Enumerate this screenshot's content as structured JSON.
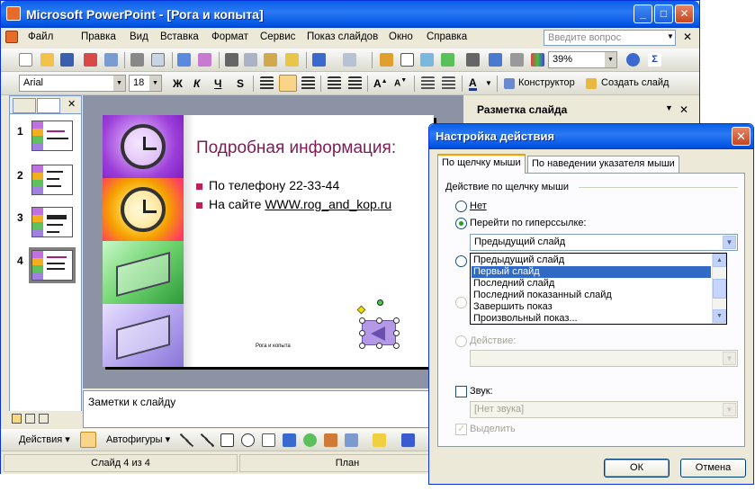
{
  "window": {
    "title": "Microsoft PowerPoint - [Рога и копыта]"
  },
  "menu": {
    "items": [
      "Файл",
      "Правка",
      "Вид",
      "Вставка",
      "Формат",
      "Сервис",
      "Показ слайдов",
      "Окно",
      "Справка"
    ],
    "ask_placeholder": "Введите вопрос"
  },
  "toolbar": {
    "zoom": "39%",
    "font": "Arial",
    "size": "18",
    "bold": "Ж",
    "italic": "К",
    "underline": "Ч",
    "shadow": "S",
    "designer_label": "Конструктор",
    "new_slide_label": "Создать слайд"
  },
  "thumbnails": [
    "1",
    "2",
    "3",
    "4"
  ],
  "slide": {
    "title": "Подробная информация:",
    "bullet1": "По телефону 22-33-44",
    "bullet2_prefix": "На сайте ",
    "bullet2_link": "WWW.rog_and_kop.ru",
    "footer": "Рога и копыта"
  },
  "notes": {
    "placeholder": "Заметки к слайду"
  },
  "drawbar": {
    "actions_label": "Действия",
    "autoshapes_label": "Автофигуры"
  },
  "statusbar": {
    "slide_info": "Слайд 4 из 4",
    "design": "План"
  },
  "taskpane": {
    "title": "Разметка слайда"
  },
  "dialog": {
    "title": "Настройка действия",
    "tab_click": "По щелчку мыши",
    "tab_hover": "По наведении указателя мыши",
    "group_label": "Действие по щелчку мыши",
    "opt_none": "Нет",
    "opt_hyperlink": "Перейти по гиперссылке:",
    "hyperlink_value": "Предыдущий слайд",
    "dropdown_options": [
      "Предыдущий слайд",
      "Первый слайд",
      "Последний слайд",
      "Последний показанный слайд",
      "Завершить показ",
      "Произвольный показ..."
    ],
    "dropdown_selected_index": 1,
    "opt_action": "Действие:",
    "sound_label": "Звук:",
    "sound_value": "[Нет звука]",
    "highlight_label": "Выделить",
    "ok_label": "ОК",
    "cancel_label": "Отмена"
  },
  "colors": {
    "title_bar": "#0054e3",
    "slide_title": "#7a1d55",
    "selection": "#316ac5"
  }
}
